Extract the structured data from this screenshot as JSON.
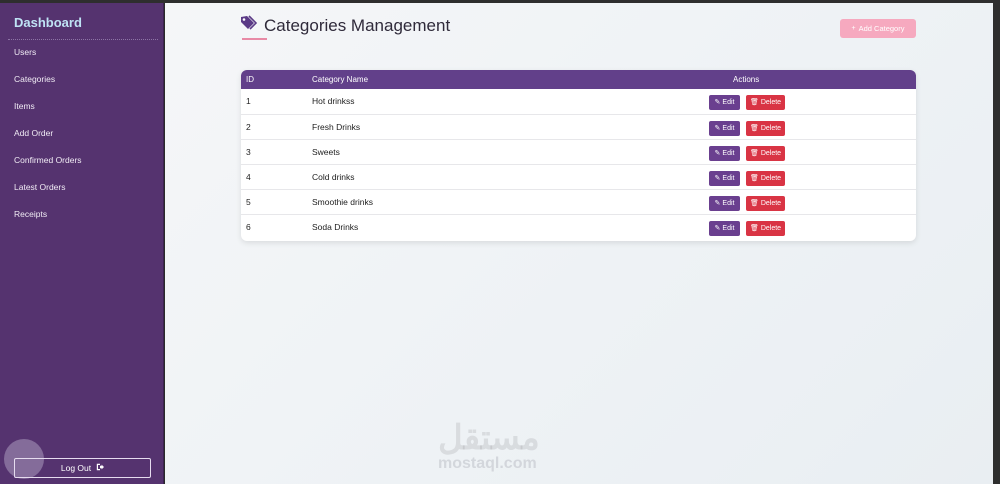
{
  "sidebar": {
    "brand": "Dashboard",
    "items": [
      {
        "label": "Users"
      },
      {
        "label": "Categories"
      },
      {
        "label": "Items"
      },
      {
        "label": "Add Order"
      },
      {
        "label": "Confirmed Orders"
      },
      {
        "label": "Latest Orders"
      },
      {
        "label": "Receipts"
      }
    ],
    "logout_label": "Log Out"
  },
  "page": {
    "title": "Categories Management",
    "add_button_label": "Add Category"
  },
  "table": {
    "headers": {
      "id": "ID",
      "name": "Category Name",
      "actions": "Actions"
    },
    "rows": [
      {
        "id": "1",
        "name": "Hot drinkss"
      },
      {
        "id": "2",
        "name": "Fresh Drinks"
      },
      {
        "id": "3",
        "name": "Sweets"
      },
      {
        "id": "4",
        "name": "Cold drinks"
      },
      {
        "id": "5",
        "name": "Smoothie drinks"
      },
      {
        "id": "6",
        "name": "Soda Drinks"
      }
    ],
    "edit_label": "Edit",
    "delete_label": "Delete"
  },
  "watermark": {
    "arabic": "مستقل",
    "site": "mostaql.com"
  },
  "colors": {
    "sidebar_bg": "#55336f",
    "table_header_bg": "#62408a",
    "edit_button": "#6a3f8f",
    "delete_button": "#d93444",
    "add_button": "#f6a9bf",
    "brand_text": "#bfe3f5"
  },
  "icons": {
    "title": "tags-icon",
    "add": "plus-icon",
    "edit": "edit-icon",
    "delete": "trash-icon",
    "logout": "sign-out-icon"
  }
}
